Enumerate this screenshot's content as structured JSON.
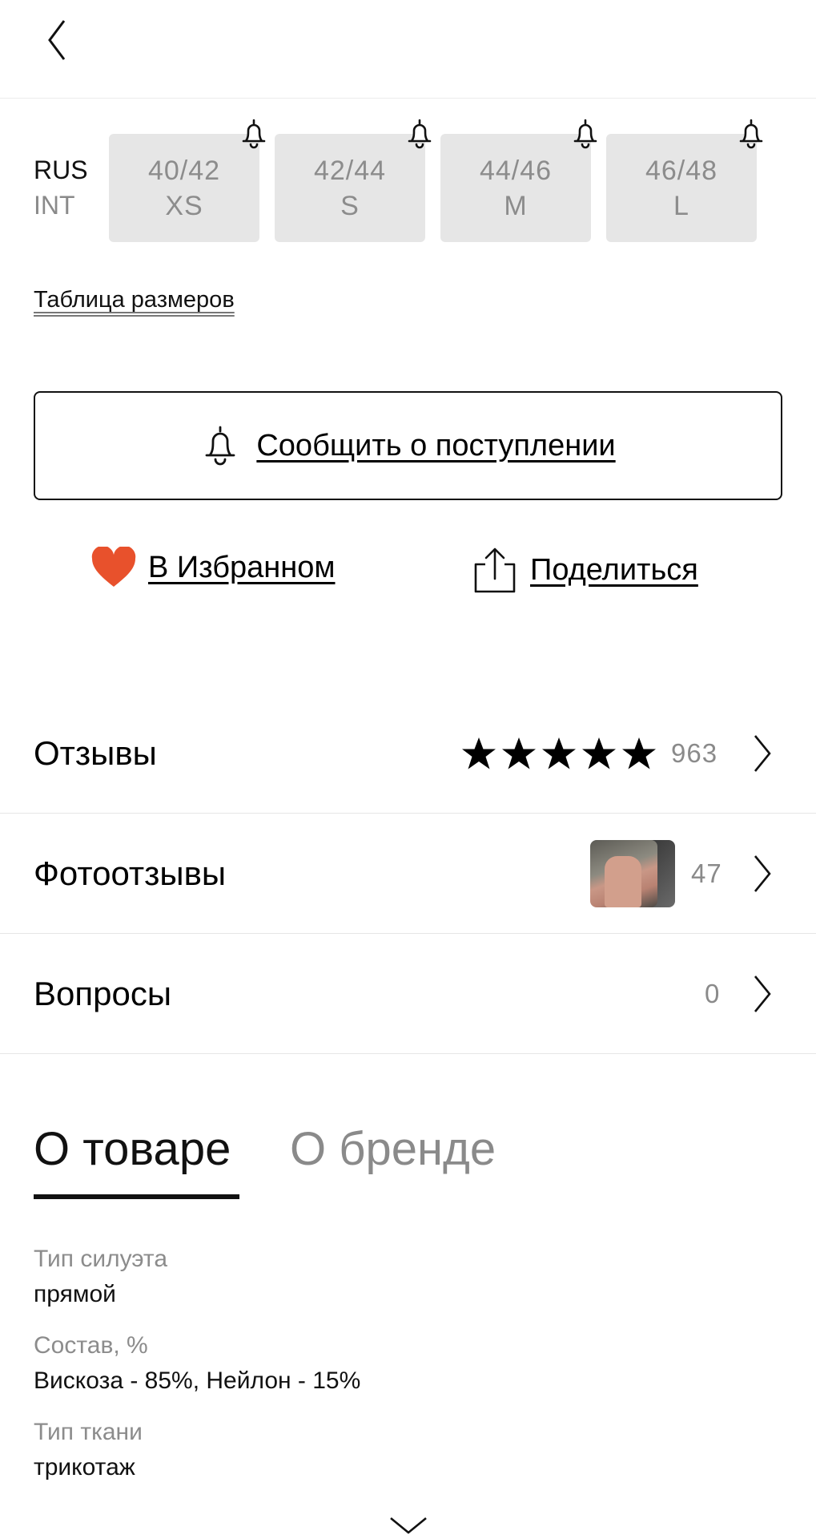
{
  "sizes": {
    "system_labels": {
      "rus": "RUS",
      "int": "INT"
    },
    "options": [
      {
        "rus": "40/42",
        "int": "XS"
      },
      {
        "rus": "42/44",
        "int": "S"
      },
      {
        "rus": "44/46",
        "int": "M"
      },
      {
        "rus": "46/48",
        "int": "L"
      }
    ],
    "size_table_link": "Таблица размеров"
  },
  "actions": {
    "notify_label": "Сообщить о поступлении",
    "favorite_label": "В Избранном",
    "share_label": "Поделиться"
  },
  "rows": {
    "reviews": {
      "title": "Отзывы",
      "count": "963",
      "rating": 5
    },
    "photo_reviews": {
      "title": "Фотоотзывы",
      "count": "47"
    },
    "questions": {
      "title": "Вопросы",
      "count": "0"
    }
  },
  "tabs": {
    "about_product": "О товаре",
    "about_brand": "О бренде"
  },
  "specs": [
    {
      "label": "Тип силуэта",
      "value": "прямой"
    },
    {
      "label": "Состав, %",
      "value": "Вискоза - 85%, Нейлон - 15%"
    },
    {
      "label": "Тип ткани",
      "value": "трикотаж"
    }
  ],
  "colors": {
    "heart": "#e8512c",
    "chip_bg": "#e6e6e6",
    "muted_text": "#8a8a8a"
  }
}
